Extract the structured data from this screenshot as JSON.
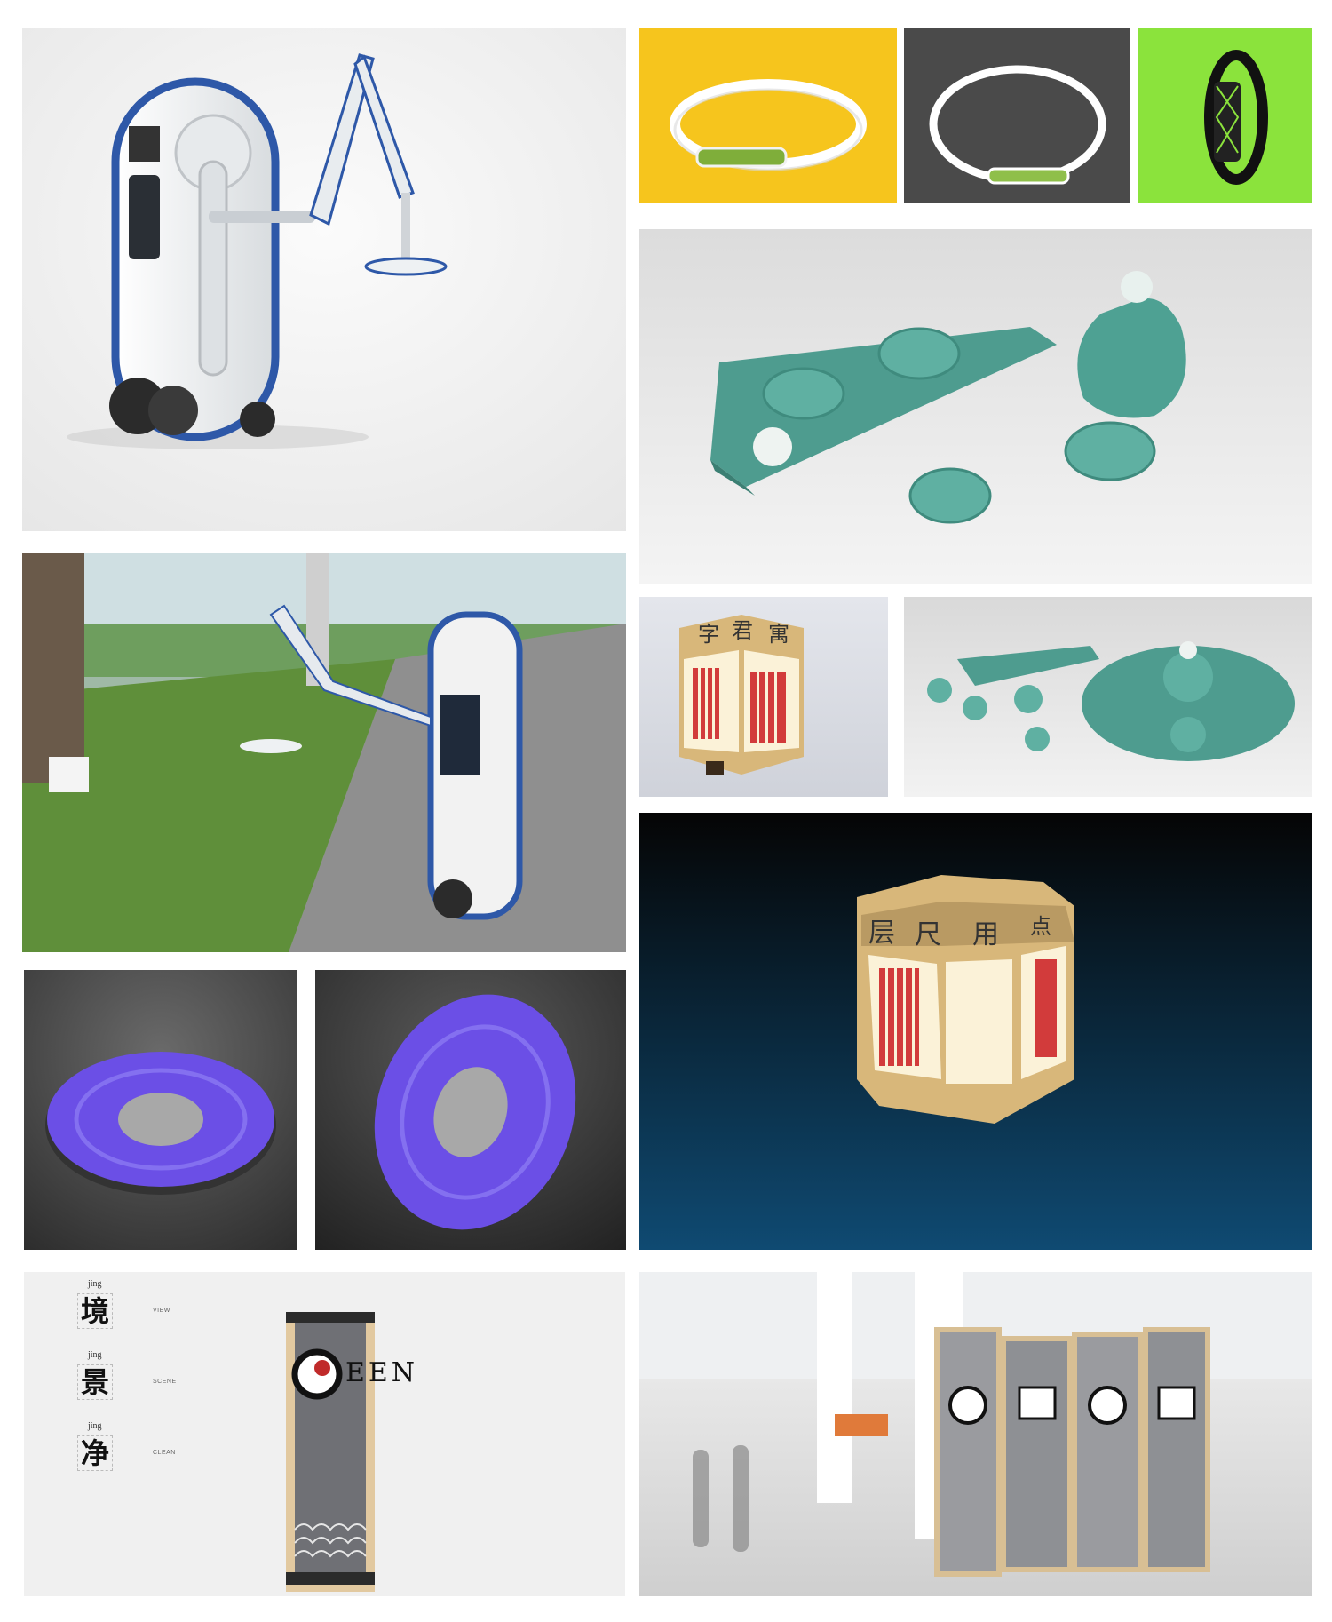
{
  "colors": {
    "background": "#ffffff",
    "tile_yellow": "#f6c51d",
    "tile_charcoal": "#4a4a4a",
    "tile_lime": "#8be33c",
    "celadon": "#5fa89a",
    "robot_blue": "#2e58a8",
    "ring_purple": "#6b4fe6",
    "night_blue": "#0f4a72"
  },
  "tiles": [
    {
      "id": "robot-studio",
      "subject": "white-blue cleaning robot with arm"
    },
    {
      "id": "bracelet-yellow",
      "subject": "white bracelet on yellow"
    },
    {
      "id": "bracelet-grey",
      "subject": "white bracelet on grey"
    },
    {
      "id": "band-lime",
      "subject": "black band on lime"
    },
    {
      "id": "celadon-set",
      "subject": "celadon lotus tea set"
    },
    {
      "id": "robot-street",
      "subject": "robot trimming hedge beside road"
    },
    {
      "id": "lantern-small",
      "subject": "wooden hexagonal lantern"
    },
    {
      "id": "celadon-set-2",
      "subject": "celadon lotus set on plate"
    },
    {
      "id": "ring-purple-1",
      "subject": "purple ring light"
    },
    {
      "id": "ring-purple-2",
      "subject": "purple ring light tilted"
    },
    {
      "id": "lantern-large",
      "subject": "lantern on blue gradient"
    },
    {
      "id": "screen-poster",
      "subject": "GEEN screen poster"
    },
    {
      "id": "screen-lobby",
      "subject": "folding screen in lobby"
    }
  ],
  "lantern_small_chars": [
    "字",
    "君",
    "寓"
  ],
  "lantern_large_chars": [
    "层",
    "尺",
    "用",
    "点"
  ],
  "poster": {
    "items": [
      {
        "pinyin": "jing",
        "hanzi": "境",
        "english": "VIEW"
      },
      {
        "pinyin": "jing",
        "hanzi": "景",
        "english": "SCENE"
      },
      {
        "pinyin": "jing",
        "hanzi": "净",
        "english": "CLEAN"
      }
    ],
    "logo_text": "EEN"
  }
}
